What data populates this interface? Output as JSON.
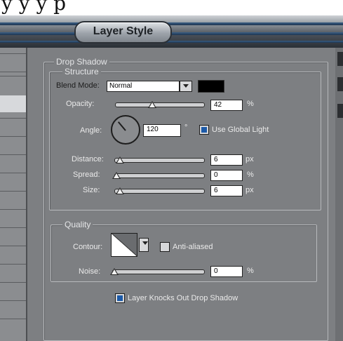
{
  "header_cropped_text": "y     y     y     p",
  "window": {
    "title": "Layer Style"
  },
  "drop_shadow": {
    "title": "Drop Shadow",
    "structure": {
      "title": "Structure",
      "blend_mode": {
        "label": "Blend Mode:",
        "value": "Normal",
        "color": "#000000"
      },
      "opacity": {
        "label": "Opacity:",
        "value": "42",
        "unit": "%",
        "fraction": 0.42
      },
      "angle": {
        "label": "Angle:",
        "value": "120",
        "unit": "°",
        "use_global_light_label": "Use Global Light",
        "use_global_light_checked": true
      },
      "distance": {
        "label": "Distance:",
        "value": "6",
        "unit": "px",
        "fraction": 0.04
      },
      "spread": {
        "label": "Spread:",
        "value": "0",
        "unit": "%",
        "fraction": 0.0
      },
      "size": {
        "label": "Size:",
        "value": "6",
        "unit": "px",
        "fraction": 0.04
      }
    },
    "quality": {
      "title": "Quality",
      "contour_label": "Contour:",
      "anti_aliased_label": "Anti-aliased",
      "anti_aliased_checked": false,
      "noise": {
        "label": "Noise:",
        "value": "0",
        "unit": "%",
        "fraction": 0.0
      }
    },
    "layer_knocks_out": {
      "label": "Layer Knocks Out Drop Shadow",
      "checked": true
    }
  }
}
